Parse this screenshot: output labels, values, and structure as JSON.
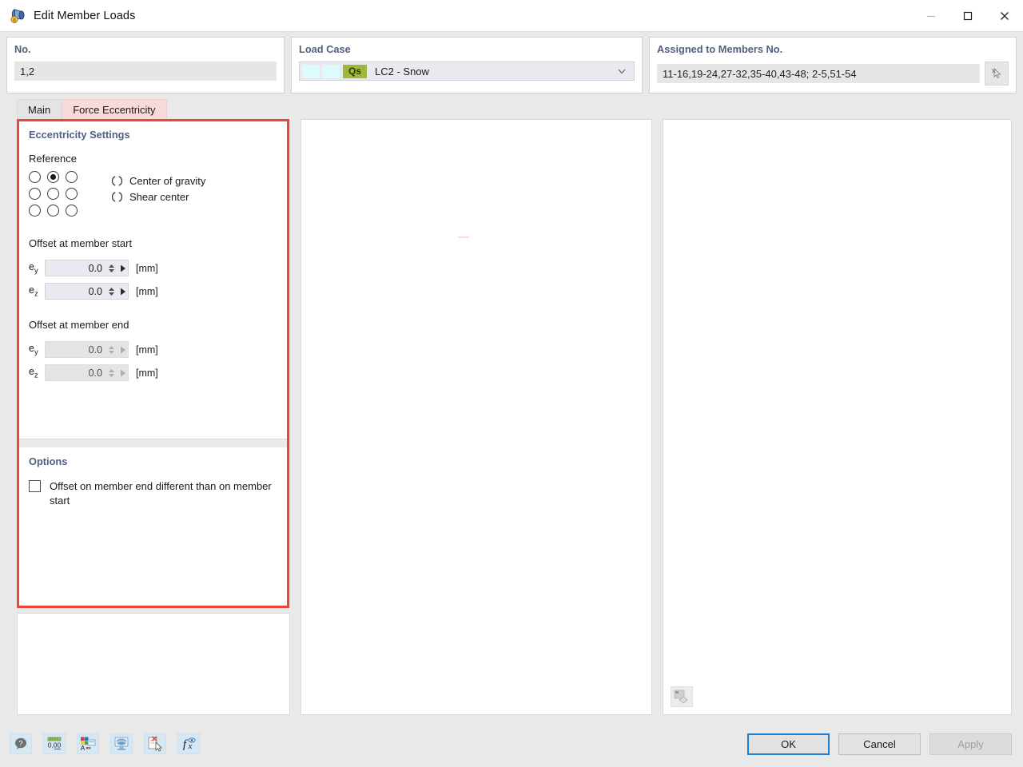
{
  "window": {
    "title": "Edit Member Loads",
    "app_icon": "member-load-icon",
    "minimize": "—",
    "maximize": "□",
    "close": "✕"
  },
  "header": {
    "no": {
      "title": "No.",
      "value": "1,2"
    },
    "load_case": {
      "title": "Load Case",
      "tag": "Qs",
      "value": "LC2 - Snow",
      "tag_color": "#9fb83c"
    },
    "assigned": {
      "title": "Assigned to Members No.",
      "value": "11-16,19-24,27-32,35-40,43-48; 2-5,51-54",
      "pick_icon": "pick-cursor-icon"
    }
  },
  "tabs": [
    {
      "label": "Main",
      "active": false
    },
    {
      "label": "Force Eccentricity",
      "active": true
    }
  ],
  "eccentricity": {
    "section_title": "Eccentricity Settings",
    "reference_label": "Reference",
    "grid_selected_index": 1,
    "grid_cells": [
      "top-left",
      "top-center",
      "top-right",
      "middle-left",
      "middle-center",
      "middle-right",
      "bottom-left",
      "bottom-center",
      "bottom-right"
    ],
    "reference_options": [
      {
        "label": "Center of gravity",
        "selected": false
      },
      {
        "label": "Shear center",
        "selected": false
      }
    ],
    "start_group": {
      "title": "Offset at member start",
      "fields": [
        {
          "label": "e",
          "sub": "y",
          "value": "0.0",
          "unit": "[mm]",
          "enabled": true
        },
        {
          "label": "e",
          "sub": "z",
          "value": "0.0",
          "unit": "[mm]",
          "enabled": true
        }
      ]
    },
    "end_group": {
      "title": "Offset at member end",
      "fields": [
        {
          "label": "e",
          "sub": "y",
          "value": "0.0",
          "unit": "[mm]",
          "enabled": false
        },
        {
          "label": "e",
          "sub": "z",
          "value": "0.0",
          "unit": "[mm]",
          "enabled": false
        }
      ]
    }
  },
  "options": {
    "section_title": "Options",
    "checkbox": {
      "label": "Offset on member end different than on member start",
      "checked": false
    }
  },
  "toolbar": [
    {
      "name": "help-icon",
      "label": "?"
    },
    {
      "name": "number-format-icon",
      "label": "0,00"
    },
    {
      "name": "display-properties-icon",
      "label": "A"
    },
    {
      "name": "view-settings-icon",
      "label": ""
    },
    {
      "name": "delete-document-icon",
      "label": ""
    },
    {
      "name": "function-icon",
      "label": "fx"
    }
  ],
  "footer_buttons": {
    "ok": "OK",
    "cancel": "Cancel",
    "apply": "Apply",
    "apply_enabled": false
  },
  "colors": {
    "highlight": "#f04438",
    "accent_blue": "#1b7fd4",
    "section_title": "#4e6180",
    "tab_active_bg": "#f8dbd9"
  }
}
